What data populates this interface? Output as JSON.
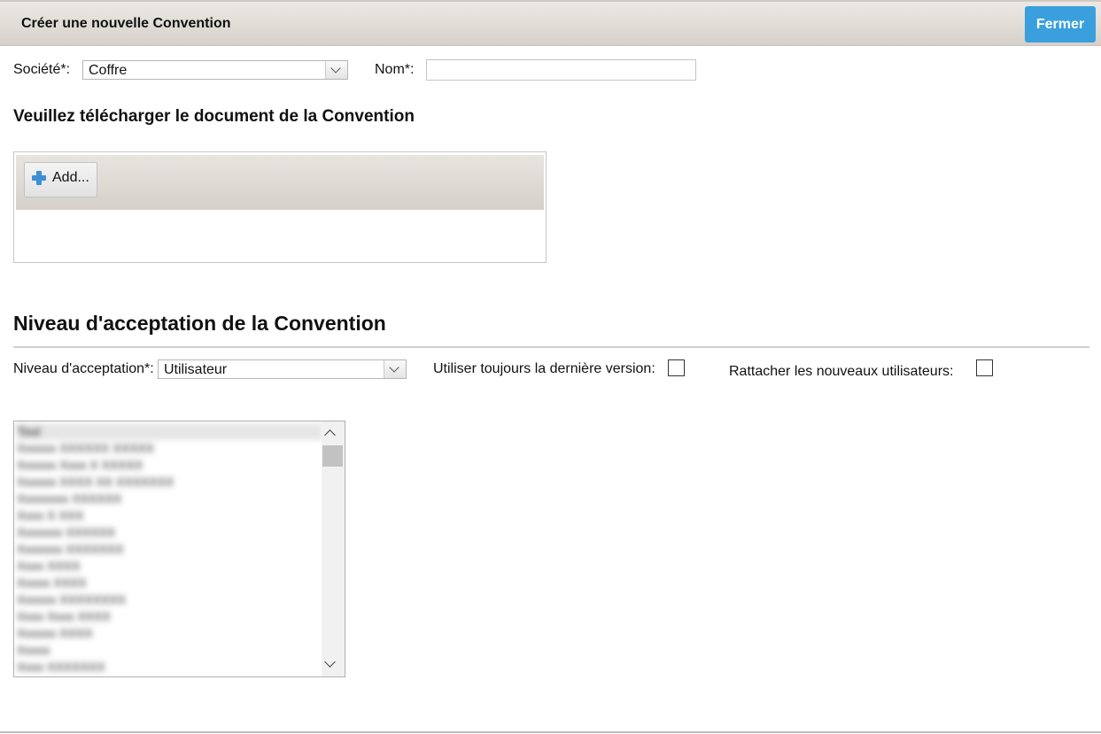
{
  "dialog": {
    "title": "Créer une nouvelle Convention",
    "close_label": "Fermer"
  },
  "form": {
    "company_label": "Société*:",
    "company_value": "Coffre",
    "name_label": "Nom*:",
    "name_value": ""
  },
  "upload": {
    "heading": "Veuillez télécharger le document de la Convention",
    "add_label": "Add..."
  },
  "acceptance": {
    "heading": "Niveau d'acceptation de la Convention",
    "level_label": "Niveau d'acceptation*:",
    "level_value": "Utilisateur",
    "latest_version_label": "Utiliser toujours la dernière version:",
    "latest_version_checked": false,
    "attach_new_users_label": "Rattacher les nouveaux utilisateurs:",
    "attach_new_users_checked": false
  },
  "user_list": {
    "items": [
      "Tout",
      "Xxxxxx XXXXXX XXXXX",
      "Xxxxxx Xxxx X XXXXX",
      "Xxxxxx XXXX XX XXXXXXX",
      "Xxxxxxxx XXXXXX",
      "Xxxx X XXX",
      "Xxxxxxx XXXXXX",
      "Xxxxxxx XXXXXXX",
      "Xxxx XXXX",
      "Xxxxx XXXX",
      "Xxxxxx XXXXXXXX",
      "Xxxx Xxxx XXXX",
      "Xxxxxx XXXX",
      "Xxxxx",
      "Xxxx XXXXXXX"
    ],
    "colors": {
      "accent": "#3aa0dd",
      "plus_icon": "#3b8fd4"
    }
  }
}
